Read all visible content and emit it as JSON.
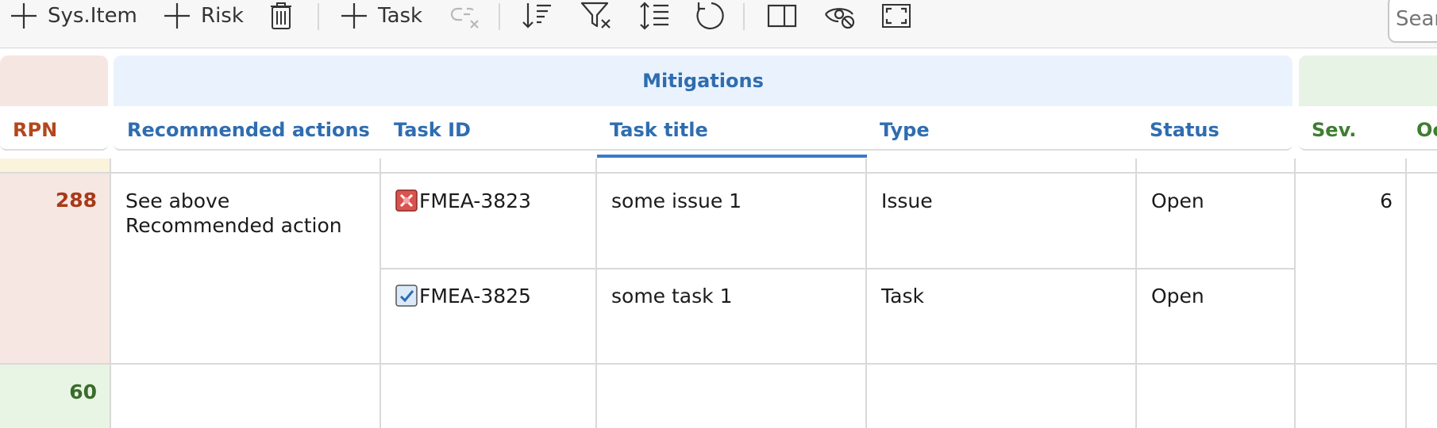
{
  "toolbar": {
    "add_sys_item": "Sys.Item",
    "add_risk": "Risk",
    "add_task": "Task",
    "search_placeholder": "Search"
  },
  "groups": {
    "mitigations": "Mitigations"
  },
  "columns": {
    "rpn": "RPN",
    "recommended_actions": "Recommended actions",
    "task_id": "Task ID",
    "task_title": "Task title",
    "type": "Type",
    "status": "Status",
    "severity": "Sev.",
    "occurrence": "Oc"
  },
  "rows": [
    {
      "rpn": "288",
      "recommended_action": "See above Recommended action",
      "severity": "6",
      "tasks": [
        {
          "id": "FMEA-3823",
          "title": "some issue 1",
          "type": "Issue",
          "status": "Open",
          "icon": "issue-icon"
        },
        {
          "id": "FMEA-3825",
          "title": "some task 1",
          "type": "Task",
          "status": "Open",
          "icon": "task-checkbox-icon"
        }
      ]
    },
    {
      "rpn": "60"
    }
  ],
  "colors": {
    "rpn_high": "#a83a18",
    "rpn_low": "#3b6b2b",
    "mitigations_header": "#2f6db0",
    "severity_header": "#3f7d33"
  }
}
